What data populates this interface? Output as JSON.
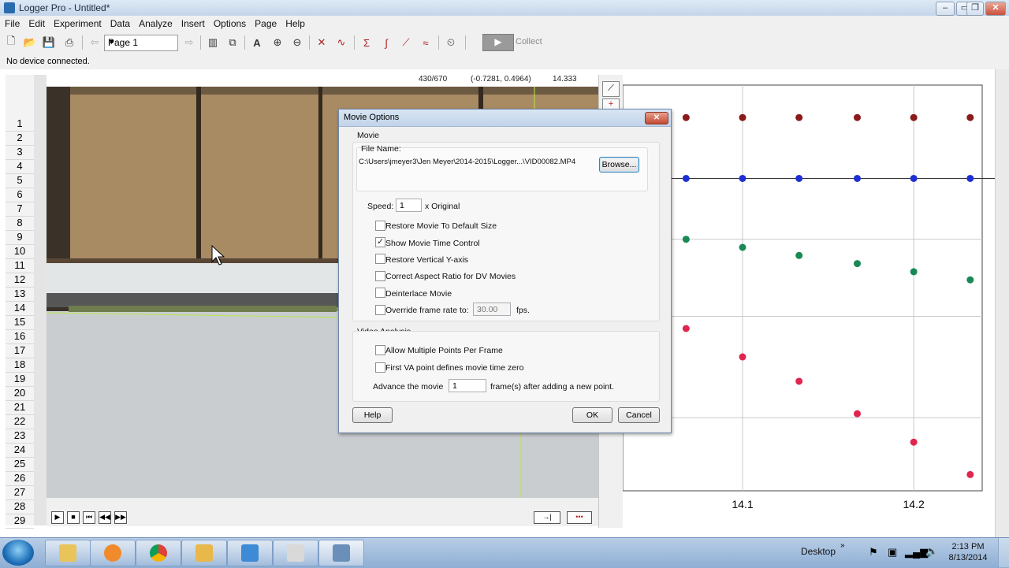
{
  "window": {
    "title": "Logger Pro - Untitled*"
  },
  "menu": [
    "File",
    "Edit",
    "Experiment",
    "Data",
    "Analyze",
    "Insert",
    "Options",
    "Page",
    "Help"
  ],
  "toolbar": {
    "page_value": "Page 1",
    "collect_label": "Collect"
  },
  "status": "No device connected.",
  "movie": {
    "frame_counter": "430/670",
    "coords": "(-0.7281, 0.4964)",
    "time": "14.333"
  },
  "row_numbers": [
    "1",
    "2",
    "3",
    "4",
    "5",
    "6",
    "7",
    "8",
    "9",
    "10",
    "11",
    "12",
    "13",
    "14",
    "15",
    "16",
    "17",
    "18",
    "19",
    "20",
    "21",
    "22",
    "23",
    "24",
    "25",
    "26",
    "27",
    "28",
    "29"
  ],
  "dialog": {
    "title": "Movie Options",
    "movie_group": "Movie",
    "file_name_label": "File Name:",
    "file_path": "C:\\Users\\jmeyer3\\Jen Meyer\\2014-2015\\Logger...\\VID00082.MP4",
    "browse_label": "Browse...",
    "speed_label": "Speed:",
    "speed_value": "1",
    "speed_unit": "x Original",
    "checkboxes": [
      {
        "label": "Restore Movie To Default Size",
        "checked": false
      },
      {
        "label": "Show Movie Time Control",
        "checked": true
      },
      {
        "label": "Restore Vertical Y-axis",
        "checked": false
      },
      {
        "label": "Correct Aspect Ratio for DV Movies",
        "checked": false
      },
      {
        "label": "Deinterlace Movie",
        "checked": false
      },
      {
        "label": "Override frame rate to:",
        "checked": false
      }
    ],
    "frame_rate_value": "30.00",
    "frame_rate_unit": "fps.",
    "video_group": "Video Analysis",
    "video_checkboxes": [
      {
        "label": "Allow Multiple Points Per Frame",
        "checked": false
      },
      {
        "label": "First VA point defines movie time zero",
        "checked": false
      }
    ],
    "advance_label": "Advance the movie",
    "advance_value": "1",
    "advance_suffix": "frame(s) after adding a new point.",
    "help_label": "Help",
    "ok_label": "OK",
    "cancel_label": "Cancel"
  },
  "graph": {
    "x_ticks": [
      "14.1",
      "14.2"
    ],
    "colors": {
      "dark_red": "#8b1a1a",
      "blue": "#1f2fd6",
      "green": "#1a8a55",
      "red": "#e0264f"
    }
  },
  "chart_data": {
    "type": "scatter",
    "x_ticks": [
      14.1,
      14.2
    ],
    "xlim": [
      14.03,
      14.24
    ],
    "series": [
      {
        "color": "#8b1a1a",
        "x": [
          14.067,
          14.1,
          14.133,
          14.167,
          14.2,
          14.233
        ],
        "y": [
          0.92,
          0.92,
          0.92,
          0.92,
          0.92,
          0.92
        ]
      },
      {
        "color": "#1f2fd6",
        "x": [
          14.067,
          14.1,
          14.133,
          14.167,
          14.2,
          14.233
        ],
        "y": [
          0.77,
          0.77,
          0.77,
          0.77,
          0.77,
          0.77
        ]
      },
      {
        "color": "#1a8a55",
        "x": [
          14.067,
          14.1,
          14.133,
          14.167,
          14.2,
          14.233
        ],
        "y": [
          0.62,
          0.6,
          0.58,
          0.56,
          0.54,
          0.52
        ]
      },
      {
        "color": "#e0264f",
        "x": [
          14.067,
          14.1,
          14.133,
          14.167,
          14.2,
          14.233
        ],
        "y": [
          0.4,
          0.33,
          0.27,
          0.19,
          0.12,
          0.04
        ]
      }
    ]
  },
  "taskbar": {
    "desktop_label": "Desktop",
    "time": "2:13 PM",
    "date": "8/13/2014"
  }
}
